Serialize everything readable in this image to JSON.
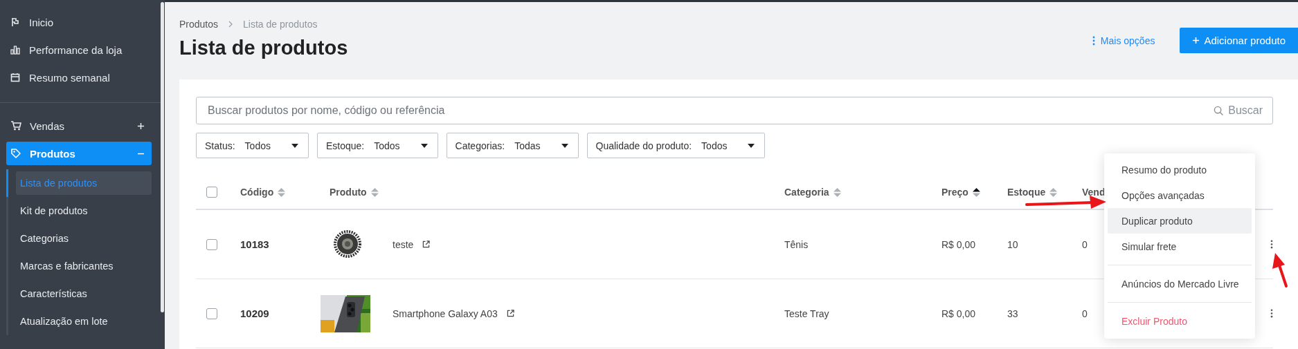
{
  "sidebar": {
    "top_items": [
      {
        "label": "Inicio"
      },
      {
        "label": "Performance da loja"
      },
      {
        "label": "Resumo semanal"
      }
    ],
    "menu": [
      {
        "label": "Vendas",
        "selected": false,
        "expanded": false
      },
      {
        "label": "Produtos",
        "selected": true,
        "expanded": true,
        "children": [
          {
            "label": "Lista de produtos",
            "selected": true
          },
          {
            "label": "Kit de produtos",
            "selected": false
          },
          {
            "label": "Categorias",
            "selected": false
          },
          {
            "label": "Marcas e fabricantes",
            "selected": false
          },
          {
            "label": "Características",
            "selected": false
          },
          {
            "label": "Atualização em lote",
            "selected": false
          }
        ]
      }
    ]
  },
  "breadcrumb": [
    "Produtos",
    "Lista de produtos"
  ],
  "title": "Lista de produtos",
  "more_options": "Mais opções",
  "add_button": "Adicionar produto",
  "search": {
    "placeholder": "Buscar produtos por nome, código ou referência",
    "button": "Buscar"
  },
  "filters": [
    {
      "label": "Status:",
      "value": "Todos"
    },
    {
      "label": "Estoque:",
      "value": "Todos"
    },
    {
      "label": "Categorias:",
      "value": "Todas"
    },
    {
      "label": "Qualidade do produto:",
      "value": "Todos"
    }
  ],
  "table": {
    "select_all": {
      "checked": false
    },
    "columns": [
      {
        "label": "Código",
        "sorted": false
      },
      {
        "label": "Produto",
        "sorted": false
      },
      {
        "label": "Categoria",
        "sorted": false
      },
      {
        "label": "Preço",
        "sorted": true
      },
      {
        "label": "Estoque",
        "sorted": false
      },
      {
        "label": "Vend"
      }
    ],
    "rows": [
      {
        "checked": false,
        "code": "10183",
        "product": "teste",
        "category": "Tênis",
        "price": "R$ 0,00",
        "stock": "10",
        "sales": "0"
      },
      {
        "checked": false,
        "code": "10209",
        "product": "Smartphone Galaxy A03",
        "category": "Teste Tray",
        "price": "R$ 0,00",
        "stock": "33",
        "sales": "0"
      }
    ]
  },
  "context_menu": {
    "groups": [
      [
        {
          "label": "Resumo do produto",
          "kind": "normal",
          "selected": false
        },
        {
          "label": "Opções avançadas",
          "kind": "normal",
          "selected": false
        },
        {
          "label": "Duplicar produto",
          "kind": "normal",
          "selected": true
        },
        {
          "label": "Simular frete",
          "kind": "normal",
          "selected": false
        }
      ],
      [
        {
          "label": "Anúncios do Mercado Livre",
          "kind": "normal",
          "selected": false
        }
      ],
      [
        {
          "label": "Excluir Produto",
          "kind": "danger",
          "selected": false
        }
      ]
    ]
  }
}
